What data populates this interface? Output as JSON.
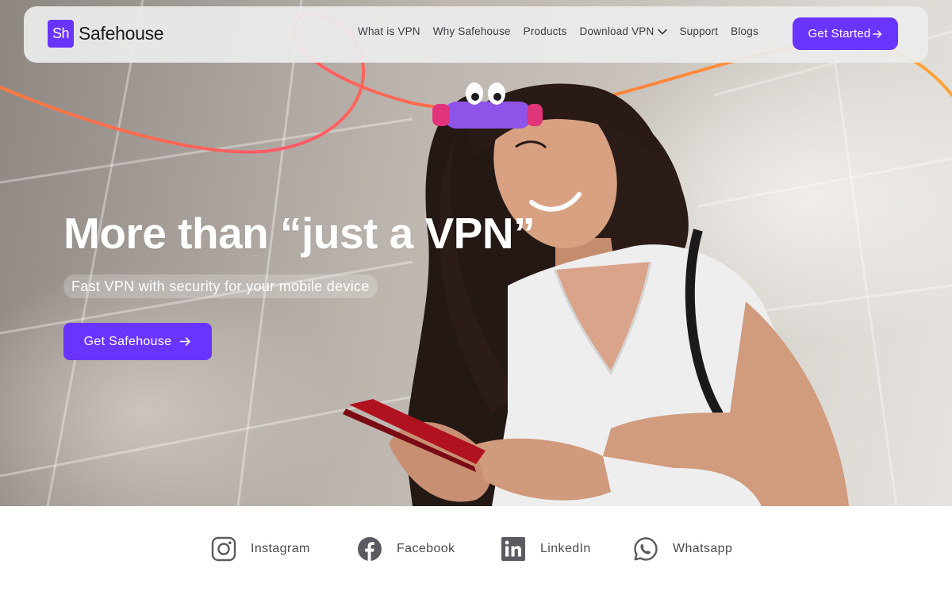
{
  "brand": {
    "badge": "Sh",
    "name": "Safehouse",
    "accent": "#6a34ff"
  },
  "nav": {
    "links": [
      {
        "label": "What is VPN"
      },
      {
        "label": "Why Safehouse"
      },
      {
        "label": "Products"
      },
      {
        "label": "Download VPN",
        "icon": "chevron-down-icon"
      },
      {
        "label": "Support"
      },
      {
        "label": "Blogs"
      }
    ],
    "cta": {
      "label": "Get Started",
      "icon": "arrow-right-icon"
    }
  },
  "hero": {
    "headline": "More than “just a VPN”",
    "subheadline": "Fast VPN with security for your mobile device",
    "cta": {
      "label": "Get Safehouse",
      "icon": "arrow-right-icon"
    }
  },
  "social": [
    {
      "label": "Instagram",
      "icon": "instagram-icon"
    },
    {
      "label": "Facebook",
      "icon": "facebook-icon"
    },
    {
      "label": "LinkedIn",
      "icon": "linkedin-icon"
    },
    {
      "label": "Whatsapp",
      "icon": "whatsapp-icon"
    }
  ]
}
